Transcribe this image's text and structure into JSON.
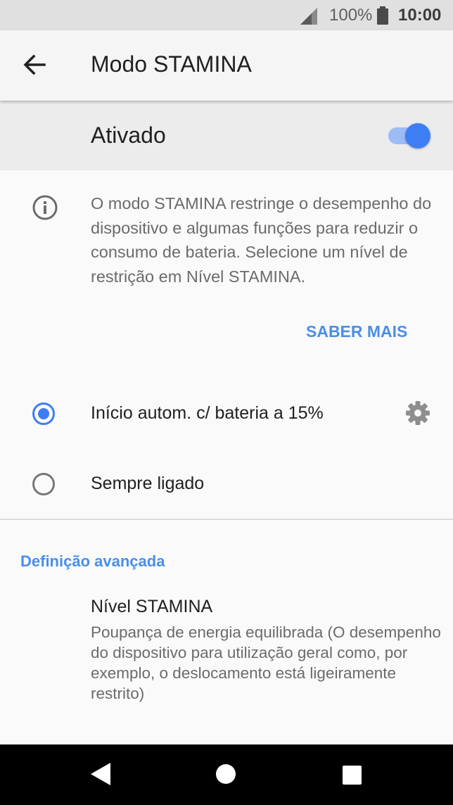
{
  "status_bar": {
    "battery": "100%",
    "time": "10:00"
  },
  "app_bar": {
    "title": "Modo STAMINA",
    "back_icon": "arrow-left-icon"
  },
  "master_switch": {
    "label": "Ativado",
    "on": true,
    "accent": "#3d7ef2"
  },
  "info": {
    "text": "O modo STAMINA restringe o desempenho do dispositivo e algumas funções para reduzir o consumo de bateria. Selecione um nível de restrição em Nível STAMINA.",
    "learn_more": "SABER MAIS"
  },
  "options": [
    {
      "label": "Início autom. c/ bateria a 15%",
      "selected": true
    },
    {
      "label": "Sempre ligado",
      "selected": false
    }
  ],
  "advanced": {
    "header": "Definição avançada",
    "level_title": "Nível STAMINA",
    "level_summary": "Poupança de energia equilibrada (O desempenho do dispositivo para utilização geral como, por exemplo, o deslocamento está ligeiramente restrito)"
  },
  "nav_bar": {
    "back": "back-triangle-icon",
    "home": "home-circle-icon",
    "recents": "recents-square-icon"
  }
}
